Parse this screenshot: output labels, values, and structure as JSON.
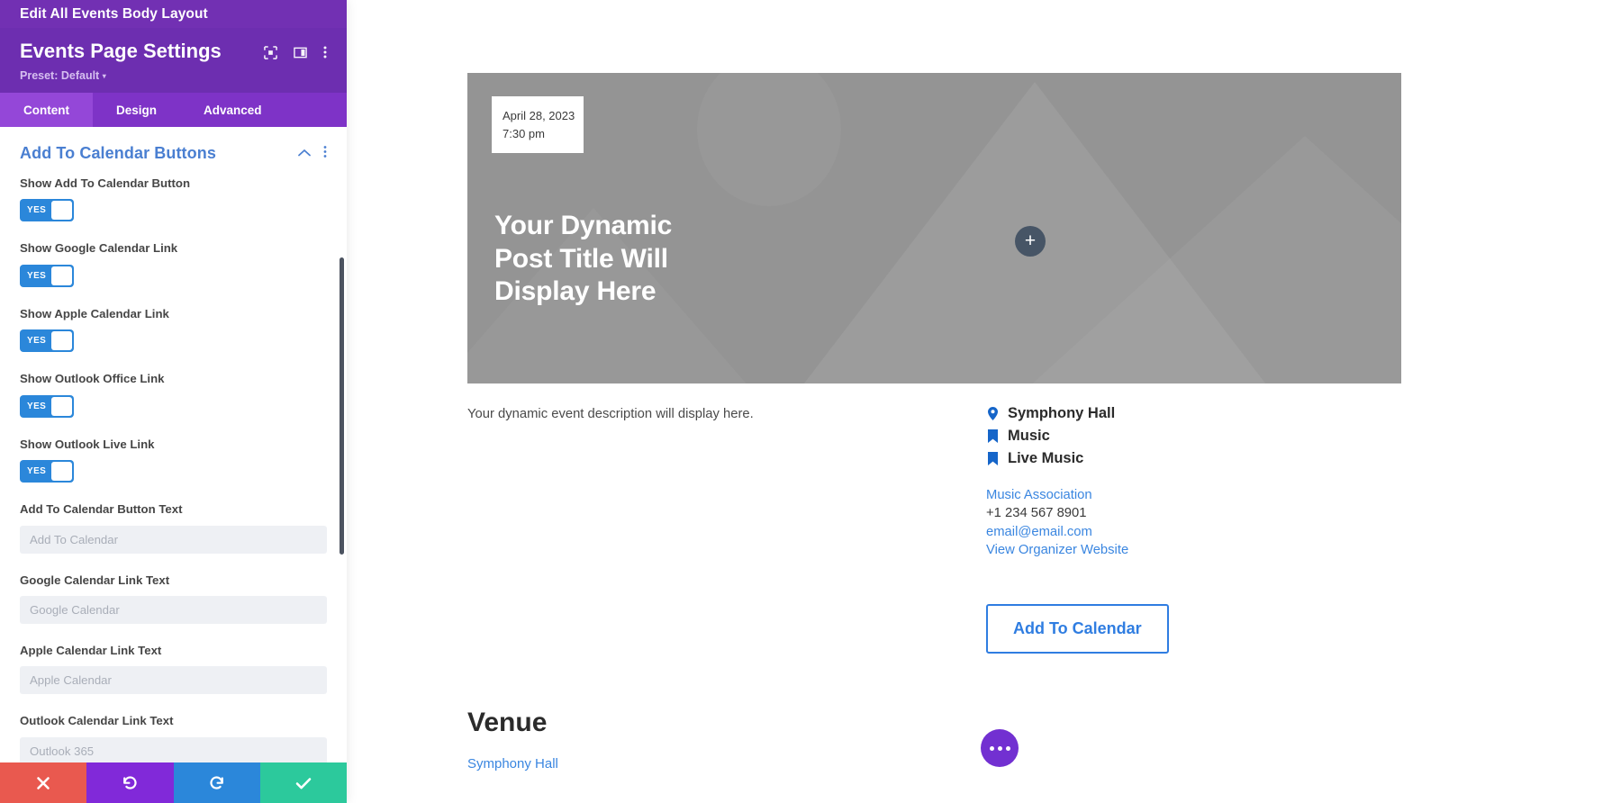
{
  "panel": {
    "topbar_title": "Edit All Events Body Layout",
    "title": "Events Page Settings",
    "preset": "Preset: Default",
    "preset_caret": "▾",
    "header_icons": [
      {
        "name": "focus-icon"
      },
      {
        "name": "panel-layout-icon"
      },
      {
        "name": "more-vertical-icon"
      }
    ],
    "tabs": [
      {
        "label": "Content",
        "active": true
      },
      {
        "label": "Design",
        "active": false
      },
      {
        "label": "Advanced",
        "active": false
      }
    ],
    "section": {
      "title": "Add To Calendar Buttons",
      "collapse_icon": "chevron-up-icon",
      "menu_icon": "more-vertical-icon"
    },
    "toggles": [
      {
        "label": "Show Add To Calendar Button",
        "value": "YES"
      },
      {
        "label": "Show Google Calendar Link",
        "value": "YES"
      },
      {
        "label": "Show Apple Calendar Link",
        "value": "YES"
      },
      {
        "label": "Show Outlook Office Link",
        "value": "YES"
      },
      {
        "label": "Show Outlook Live Link",
        "value": "YES"
      }
    ],
    "inputs": [
      {
        "label": "Add To Calendar Button Text",
        "value": "",
        "placeholder": "Add To Calendar"
      },
      {
        "label": "Google Calendar Link Text",
        "value": "",
        "placeholder": "Google Calendar"
      },
      {
        "label": "Apple Calendar Link Text",
        "value": "",
        "placeholder": "Apple Calendar"
      },
      {
        "label": "Outlook Calendar Link Text",
        "value": "",
        "placeholder": "Outlook 365"
      }
    ],
    "footer_buttons": [
      {
        "name": "cancel-button",
        "icon": "close-icon",
        "color": "#e9594f"
      },
      {
        "name": "undo-button",
        "icon": "undo-icon",
        "color": "#8129d9"
      },
      {
        "name": "redo-button",
        "icon": "redo-icon",
        "color": "#2b87da"
      },
      {
        "name": "save-button",
        "icon": "check-icon",
        "color": "#2cc99c"
      }
    ]
  },
  "canvas": {
    "hero": {
      "date": "April 28, 2023",
      "time": "7:30 pm",
      "title_line1": "Your Dynamic",
      "title_line2": "Post Title Will",
      "title_line3": "Display Here",
      "add_module_icon": "plus-icon"
    },
    "description": "Your dynamic event description will display here.",
    "meta": [
      {
        "icon": "location-pin-icon",
        "text": "Symphony Hall"
      },
      {
        "icon": "bookmark-icon",
        "text": "Music"
      },
      {
        "icon": "bookmark-icon",
        "text": "Live Music"
      }
    ],
    "organizer": {
      "name": "Music Association",
      "phone": "+1 234 567 8901",
      "email": "email@email.com",
      "website": "View Organizer Website"
    },
    "add_to_calendar_button": "Add To Calendar",
    "venue_heading": "Venue",
    "venue_link": "Symphony Hall",
    "fab_icon": "more-horizontal-icon"
  },
  "colors": {
    "panel_purple": "#6d2eb0",
    "panel_topbar": "#7230b3",
    "tab_active": "#9447d8",
    "toggle_blue": "#2b87da",
    "section_title": "#4a7fd1",
    "link_blue": "#3a86e0",
    "accent_blue": "#2f7de1",
    "fab_purple": "#7230d1"
  }
}
